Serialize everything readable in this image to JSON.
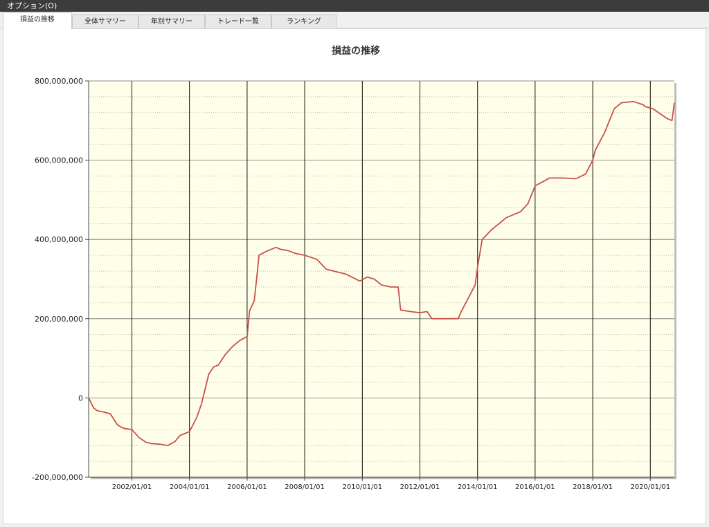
{
  "menu": {
    "options_label": "オプション(O)"
  },
  "tabs": [
    {
      "label": "損益の推移",
      "active": true
    },
    {
      "label": "全体サマリー",
      "active": false
    },
    {
      "label": "年別サマリー",
      "active": false
    },
    {
      "label": "トレード一覧",
      "active": false
    },
    {
      "label": "ランキング",
      "active": false
    }
  ],
  "colors": {
    "plot_background": "#fefee9",
    "line": "#c8504b",
    "menubar": "#3c3c3c"
  },
  "chart_data": {
    "type": "line",
    "title": "損益の推移",
    "xlabel": "",
    "ylabel": "",
    "ylim": [
      -200000000,
      800000000
    ],
    "xlim": [
      "2000-07-01",
      "2020-11-01"
    ],
    "y_ticks": [
      {
        "value": 800000000,
        "label": "800,000,000"
      },
      {
        "value": 600000000,
        "label": "600,000,000"
      },
      {
        "value": 400000000,
        "label": "400,000,000"
      },
      {
        "value": 200000000,
        "label": "200,000,000"
      },
      {
        "value": 0,
        "label": "0"
      },
      {
        "value": -200000000,
        "label": "-200,000,000"
      }
    ],
    "x_ticks": [
      "2002/01/01",
      "2004/01/01",
      "2006/01/01",
      "2008/01/01",
      "2010/01/01",
      "2012/01/01",
      "2014/01/01",
      "2016/01/01",
      "2018/01/01",
      "2020/01/01"
    ],
    "grid": true,
    "series": [
      {
        "x": [
          "2000-07-01",
          "2000-09-01",
          "2000-10-15",
          "2001-01-01",
          "2001-04-01",
          "2001-07-01",
          "2001-09-01",
          "2001-10-01",
          "2002-01-01",
          "2002-04-01",
          "2002-07-01",
          "2002-09-01",
          "2003-01-01",
          "2003-04-01",
          "2003-07-01",
          "2003-09-01",
          "2003-11-01",
          "2004-01-01",
          "2004-04-01",
          "2004-06-01",
          "2004-09-01",
          "2004-11-01",
          "2005-01-01",
          "2005-04-01",
          "2005-07-01",
          "2005-10-01",
          "2006-01-01",
          "2006-02-01",
          "2006-04-01",
          "2006-05-01",
          "2006-06-01",
          "2006-09-01",
          "2007-01-01",
          "2007-03-01",
          "2007-06-01",
          "2007-09-01",
          "2008-01-01",
          "2008-06-01",
          "2008-10-01",
          "2009-01-01",
          "2009-06-01",
          "2009-12-01",
          "2010-03-01",
          "2010-06-01",
          "2010-09-01",
          "2011-01-01",
          "2011-04-01",
          "2011-05-01",
          "2011-09-01",
          "2012-01-01",
          "2012-04-01",
          "2012-06-01",
          "2012-07-01",
          "2013-01-01",
          "2013-05-01",
          "2013-06-01",
          "2013-09-01",
          "2013-12-01",
          "2014-01-01",
          "2014-03-01",
          "2014-07-01",
          "2015-01-01",
          "2015-07-01",
          "2015-10-01",
          "2016-01-01",
          "2016-07-01",
          "2017-01-01",
          "2017-06-01",
          "2017-10-01",
          "2018-01-01",
          "2018-02-01",
          "2018-06-01",
          "2018-10-01",
          "2019-01-01",
          "2019-06-01",
          "2019-10-01",
          "2019-11-01",
          "2020-02-01",
          "2020-08-01",
          "2020-10-01",
          "2020-11-01"
        ],
        "y": [
          0,
          -25000000,
          -32000000,
          -35000000,
          -40000000,
          -68000000,
          -75000000,
          -77000000,
          -80000000,
          -100000000,
          -112000000,
          -115000000,
          -117000000,
          -120000000,
          -110000000,
          -95000000,
          -90000000,
          -85000000,
          -50000000,
          -15000000,
          60000000,
          78000000,
          83000000,
          110000000,
          130000000,
          145000000,
          155000000,
          220000000,
          245000000,
          300000000,
          360000000,
          370000000,
          380000000,
          375000000,
          372000000,
          365000000,
          360000000,
          350000000,
          325000000,
          320000000,
          313000000,
          295000000,
          305000000,
          300000000,
          285000000,
          280000000,
          280000000,
          222000000,
          218000000,
          215000000,
          218000000,
          200000000,
          200000000,
          200000000,
          200000000,
          215000000,
          250000000,
          285000000,
          330000000,
          400000000,
          425000000,
          455000000,
          470000000,
          490000000,
          535000000,
          555000000,
          555000000,
          553000000,
          565000000,
          600000000,
          625000000,
          670000000,
          730000000,
          745000000,
          748000000,
          740000000,
          735000000,
          730000000,
          705000000,
          700000000,
          745000000
        ]
      }
    ]
  }
}
